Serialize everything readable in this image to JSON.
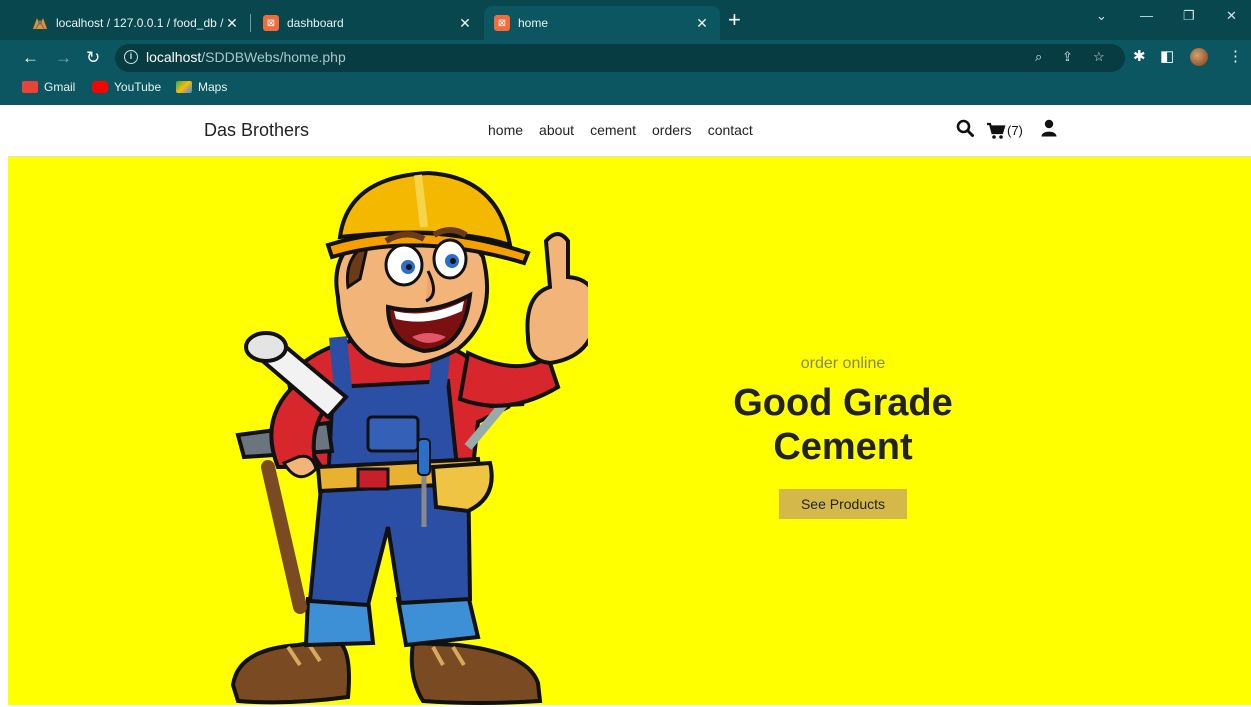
{
  "browser": {
    "tabs": [
      {
        "label": "localhost / 127.0.0.1 / food_db / ",
        "active": false
      },
      {
        "label": "dashboard",
        "active": false
      },
      {
        "label": "home",
        "active": true
      }
    ],
    "url_host": "localhost",
    "url_path": "/SDDBWebs/home.php",
    "bookmarks": [
      "Gmail",
      "YouTube",
      "Maps"
    ]
  },
  "site": {
    "brand": "Das Brothers",
    "nav": [
      "home",
      "about",
      "cement",
      "orders",
      "contact"
    ],
    "cart_count": "(7)"
  },
  "hero": {
    "eyebrow": "order online",
    "headline_line1": "Good Grade",
    "headline_line2": "Cement",
    "cta": "See Products"
  },
  "colors": {
    "chrome": "#0b5660",
    "hero_bg": "#ffff00",
    "cta_bg": "#d4b84a"
  }
}
